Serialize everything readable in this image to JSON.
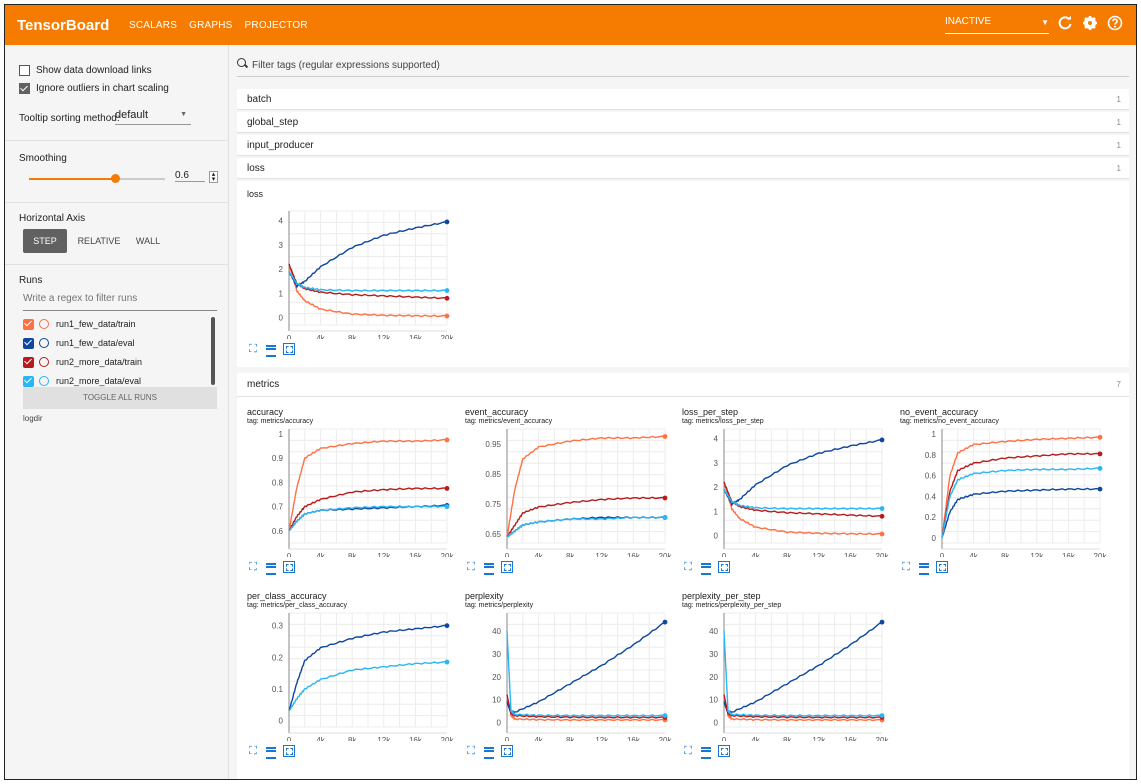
{
  "app": {
    "title": "TensorBoard",
    "accent": "#f57c00"
  },
  "nav": {
    "tabs": [
      "SCALARS",
      "GRAPHS",
      "PROJECTOR"
    ],
    "active": "SCALARS"
  },
  "status": {
    "value": "INACTIVE"
  },
  "toolbar_icons": [
    "refresh-icon",
    "settings-icon",
    "help-icon"
  ],
  "sidebar": {
    "show_download": "Show data download links",
    "ignore_outliers": "Ignore outliers in chart scaling",
    "show_download_checked": false,
    "ignore_outliers_checked": true,
    "tooltip_label": "Tooltip sorting method:",
    "tooltip_value": "default",
    "smoothing_label": "Smoothing",
    "smoothing_value": "0.6",
    "smoothing_fraction": 0.6,
    "haxis_label": "Horizontal Axis",
    "haxis_options": [
      "STEP",
      "RELATIVE",
      "WALL"
    ],
    "haxis_active": "STEP",
    "runs_label": "Runs",
    "runs_placeholder": "Write a regex to filter runs",
    "runs": [
      {
        "name": "run1_few_data/train",
        "color": "#ff7043",
        "checked": true
      },
      {
        "name": "run1_few_data/eval",
        "color": "#0d47a1",
        "checked": true
      },
      {
        "name": "run2_more_data/train",
        "color": "#b71c1c",
        "checked": true
      },
      {
        "name": "run2_more_data/eval",
        "color": "#29b6f6",
        "checked": true
      }
    ],
    "toggle_all": "TOGGLE ALL RUNS",
    "logdir": "logdir"
  },
  "filter": {
    "placeholder": "Filter tags (regular expressions supported)"
  },
  "categories": [
    {
      "name": "batch",
      "count": "1"
    },
    {
      "name": "global_step",
      "count": "1"
    },
    {
      "name": "input_producer",
      "count": "1"
    },
    {
      "name": "loss",
      "count": "1"
    }
  ],
  "metrics_category": {
    "name": "metrics",
    "count": "7"
  },
  "x_ticks": [
    "0",
    "4k",
    "8k",
    "12k",
    "16k",
    "20k"
  ],
  "cards": {
    "loss": {
      "title": "loss",
      "tag": "",
      "yticks": [
        "0",
        "1",
        "2",
        "3",
        "4"
      ],
      "ymin": -0.3,
      "ymax": 4.4
    },
    "accuracy": {
      "title": "accuracy",
      "tag": "tag: metrics/accuracy",
      "yticks": [
        "0.6",
        "0.7",
        "0.8",
        "0.9",
        "1"
      ],
      "ymin": 0.55,
      "ymax": 1.02
    },
    "event_accuracy": {
      "title": "event_accuracy",
      "tag": "tag: metrics/event_accuracy",
      "yticks": [
        "0.65",
        "0.75",
        "0.85",
        "0.95"
      ],
      "ymin": 0.62,
      "ymax": 1.0
    },
    "loss_per_step": {
      "title": "loss_per_step",
      "tag": "tag: metrics/loss_per_step",
      "yticks": [
        "0",
        "1",
        "2",
        "3",
        "4"
      ],
      "ymin": -0.3,
      "ymax": 4.4
    },
    "no_event_accuracy": {
      "title": "no_event_accuracy",
      "tag": "tag: metrics/no_event_accuracy",
      "yticks": [
        "0",
        "0.2",
        "0.4",
        "0.6",
        "0.8",
        "1"
      ],
      "ymin": -0.05,
      "ymax": 1.05
    },
    "per_class_accuracy": {
      "title": "per_class_accuracy",
      "tag": "tag: metrics/per_class_accuracy",
      "yticks": [
        "0",
        "0.1",
        "0.2",
        "0.3"
      ],
      "ymin": -0.02,
      "ymax": 0.34
    },
    "perplexity": {
      "title": "perplexity",
      "tag": "tag: metrics/perplexity",
      "yticks": [
        "0",
        "10",
        "20",
        "30",
        "40"
      ],
      "ymin": -2,
      "ymax": 48
    },
    "perplexity_per_step": {
      "title": "perplexity_per_step",
      "tag": "tag: metrics/perplexity_per_step",
      "yticks": [
        "0",
        "10",
        "20",
        "30",
        "40"
      ],
      "ymin": -2,
      "ymax": 48
    }
  },
  "chart_data": [
    {
      "type": "line",
      "title": "loss",
      "x": [
        0,
        1000,
        2000,
        4000,
        8000,
        12000,
        16000,
        20000
      ],
      "series": [
        {
          "name": "run1_few_data/train",
          "color": "#ff7043",
          "values": [
            2.2,
            1.1,
            0.7,
            0.35,
            0.15,
            0.1,
            0.08,
            0.07
          ]
        },
        {
          "name": "run1_few_data/eval",
          "color": "#0d47a1",
          "values": [
            1.9,
            1.3,
            1.5,
            2.1,
            2.9,
            3.4,
            3.7,
            3.95
          ]
        },
        {
          "name": "run2_more_data/train",
          "color": "#b71c1c",
          "values": [
            2.2,
            1.4,
            1.2,
            1.05,
            0.95,
            0.9,
            0.85,
            0.8
          ]
        },
        {
          "name": "run2_more_data/eval",
          "color": "#29b6f6",
          "values": [
            1.9,
            1.4,
            1.25,
            1.15,
            1.12,
            1.12,
            1.12,
            1.12
          ]
        }
      ]
    },
    {
      "type": "line",
      "title": "accuracy",
      "x": [
        0,
        1000,
        2000,
        4000,
        8000,
        12000,
        16000,
        20000
      ],
      "series": [
        {
          "name": "run1_few_data/train",
          "color": "#ff7043",
          "values": [
            0.6,
            0.78,
            0.9,
            0.94,
            0.96,
            0.97,
            0.97,
            0.975
          ]
        },
        {
          "name": "run1_few_data/eval",
          "color": "#0d47a1",
          "values": [
            0.6,
            0.64,
            0.67,
            0.685,
            0.69,
            0.695,
            0.7,
            0.705
          ]
        },
        {
          "name": "run2_more_data/train",
          "color": "#b71c1c",
          "values": [
            0.6,
            0.66,
            0.7,
            0.73,
            0.76,
            0.77,
            0.775,
            0.775
          ]
        },
        {
          "name": "run2_more_data/eval",
          "color": "#29b6f6",
          "values": [
            0.6,
            0.64,
            0.67,
            0.685,
            0.695,
            0.7,
            0.7,
            0.7
          ]
        }
      ]
    },
    {
      "type": "line",
      "title": "event_accuracy",
      "x": [
        0,
        1000,
        2000,
        4000,
        8000,
        12000,
        16000,
        20000
      ],
      "series": [
        {
          "name": "run1_few_data/train",
          "color": "#ff7043",
          "values": [
            0.64,
            0.8,
            0.9,
            0.94,
            0.96,
            0.97,
            0.97,
            0.975
          ]
        },
        {
          "name": "run1_few_data/eval",
          "color": "#0d47a1",
          "values": [
            0.64,
            0.66,
            0.68,
            0.69,
            0.7,
            0.705,
            0.705,
            0.705
          ]
        },
        {
          "name": "run2_more_data/train",
          "color": "#b71c1c",
          "values": [
            0.64,
            0.68,
            0.72,
            0.74,
            0.755,
            0.765,
            0.77,
            0.77
          ]
        },
        {
          "name": "run2_more_data/eval",
          "color": "#29b6f6",
          "values": [
            0.64,
            0.66,
            0.68,
            0.69,
            0.7,
            0.7,
            0.705,
            0.705
          ]
        }
      ]
    },
    {
      "type": "line",
      "title": "loss_per_step",
      "x": [
        0,
        1000,
        2000,
        4000,
        8000,
        12000,
        16000,
        20000
      ],
      "series": [
        {
          "name": "run1_few_data/train",
          "color": "#ff7043",
          "values": [
            2.2,
            1.1,
            0.7,
            0.35,
            0.15,
            0.1,
            0.08,
            0.07
          ]
        },
        {
          "name": "run1_few_data/eval",
          "color": "#0d47a1",
          "values": [
            1.9,
            1.3,
            1.5,
            2.1,
            2.9,
            3.4,
            3.7,
            3.95
          ]
        },
        {
          "name": "run2_more_data/train",
          "color": "#b71c1c",
          "values": [
            2.2,
            1.4,
            1.2,
            1.05,
            0.95,
            0.9,
            0.85,
            0.8
          ]
        },
        {
          "name": "run2_more_data/eval",
          "color": "#29b6f6",
          "values": [
            1.9,
            1.4,
            1.25,
            1.15,
            1.12,
            1.12,
            1.12,
            1.12
          ]
        }
      ]
    },
    {
      "type": "line",
      "title": "no_event_accuracy",
      "x": [
        0,
        1000,
        2000,
        4000,
        8000,
        12000,
        16000,
        20000
      ],
      "series": [
        {
          "name": "run1_few_data/train",
          "color": "#ff7043",
          "values": [
            0.0,
            0.6,
            0.82,
            0.9,
            0.93,
            0.95,
            0.96,
            0.97
          ]
        },
        {
          "name": "run1_few_data/eval",
          "color": "#0d47a1",
          "values": [
            0.0,
            0.25,
            0.37,
            0.42,
            0.45,
            0.46,
            0.47,
            0.47
          ]
        },
        {
          "name": "run2_more_data/train",
          "color": "#b71c1c",
          "values": [
            0.0,
            0.45,
            0.65,
            0.72,
            0.77,
            0.79,
            0.81,
            0.81
          ]
        },
        {
          "name": "run2_more_data/eval",
          "color": "#29b6f6",
          "values": [
            0.0,
            0.4,
            0.56,
            0.62,
            0.65,
            0.66,
            0.66,
            0.67
          ]
        }
      ]
    },
    {
      "type": "line",
      "title": "per_class_accuracy",
      "x": [
        0,
        1000,
        2000,
        4000,
        8000,
        12000,
        16000,
        20000
      ],
      "series": [
        {
          "name": "run1_few_data/eval",
          "color": "#0d47a1",
          "values": [
            0.03,
            0.12,
            0.19,
            0.23,
            0.26,
            0.28,
            0.29,
            0.3
          ]
        },
        {
          "name": "run2_more_data/eval",
          "color": "#29b6f6",
          "values": [
            0.03,
            0.07,
            0.1,
            0.13,
            0.16,
            0.17,
            0.18,
            0.185
          ]
        }
      ]
    },
    {
      "type": "line",
      "title": "perplexity",
      "x": [
        0,
        500,
        1000,
        4000,
        8000,
        12000,
        16000,
        20000
      ],
      "series": [
        {
          "name": "run1_few_data/train",
          "color": "#ff7043",
          "values": [
            12,
            3,
            1.5,
            1.2,
            1.1,
            1.1,
            1.1,
            1.1
          ]
        },
        {
          "name": "run1_few_data/eval",
          "color": "#0d47a1",
          "values": [
            9,
            4,
            4.5,
            9,
            17,
            25,
            34,
            44
          ]
        },
        {
          "name": "run2_more_data/train",
          "color": "#b71c1c",
          "values": [
            12,
            4,
            3,
            2.5,
            2.3,
            2.2,
            2.2,
            2.2
          ]
        },
        {
          "name": "run2_more_data/eval",
          "color": "#29b6f6",
          "values": [
            40,
            5,
            3.5,
            3.1,
            3,
            3,
            3,
            3
          ]
        }
      ]
    },
    {
      "type": "line",
      "title": "perplexity_per_step",
      "x": [
        0,
        500,
        1000,
        4000,
        8000,
        12000,
        16000,
        20000
      ],
      "series": [
        {
          "name": "run1_few_data/train",
          "color": "#ff7043",
          "values": [
            12,
            3,
            1.5,
            1.2,
            1.1,
            1.1,
            1.1,
            1.1
          ]
        },
        {
          "name": "run1_few_data/eval",
          "color": "#0d47a1",
          "values": [
            9,
            4,
            4.5,
            9,
            17,
            25,
            34,
            44
          ]
        },
        {
          "name": "run2_more_data/train",
          "color": "#b71c1c",
          "values": [
            12,
            4,
            3,
            2.5,
            2.3,
            2.2,
            2.2,
            2.2
          ]
        },
        {
          "name": "run2_more_data/eval",
          "color": "#29b6f6",
          "values": [
            40,
            5,
            3.5,
            3.1,
            3,
            3,
            3,
            3
          ]
        }
      ]
    }
  ]
}
